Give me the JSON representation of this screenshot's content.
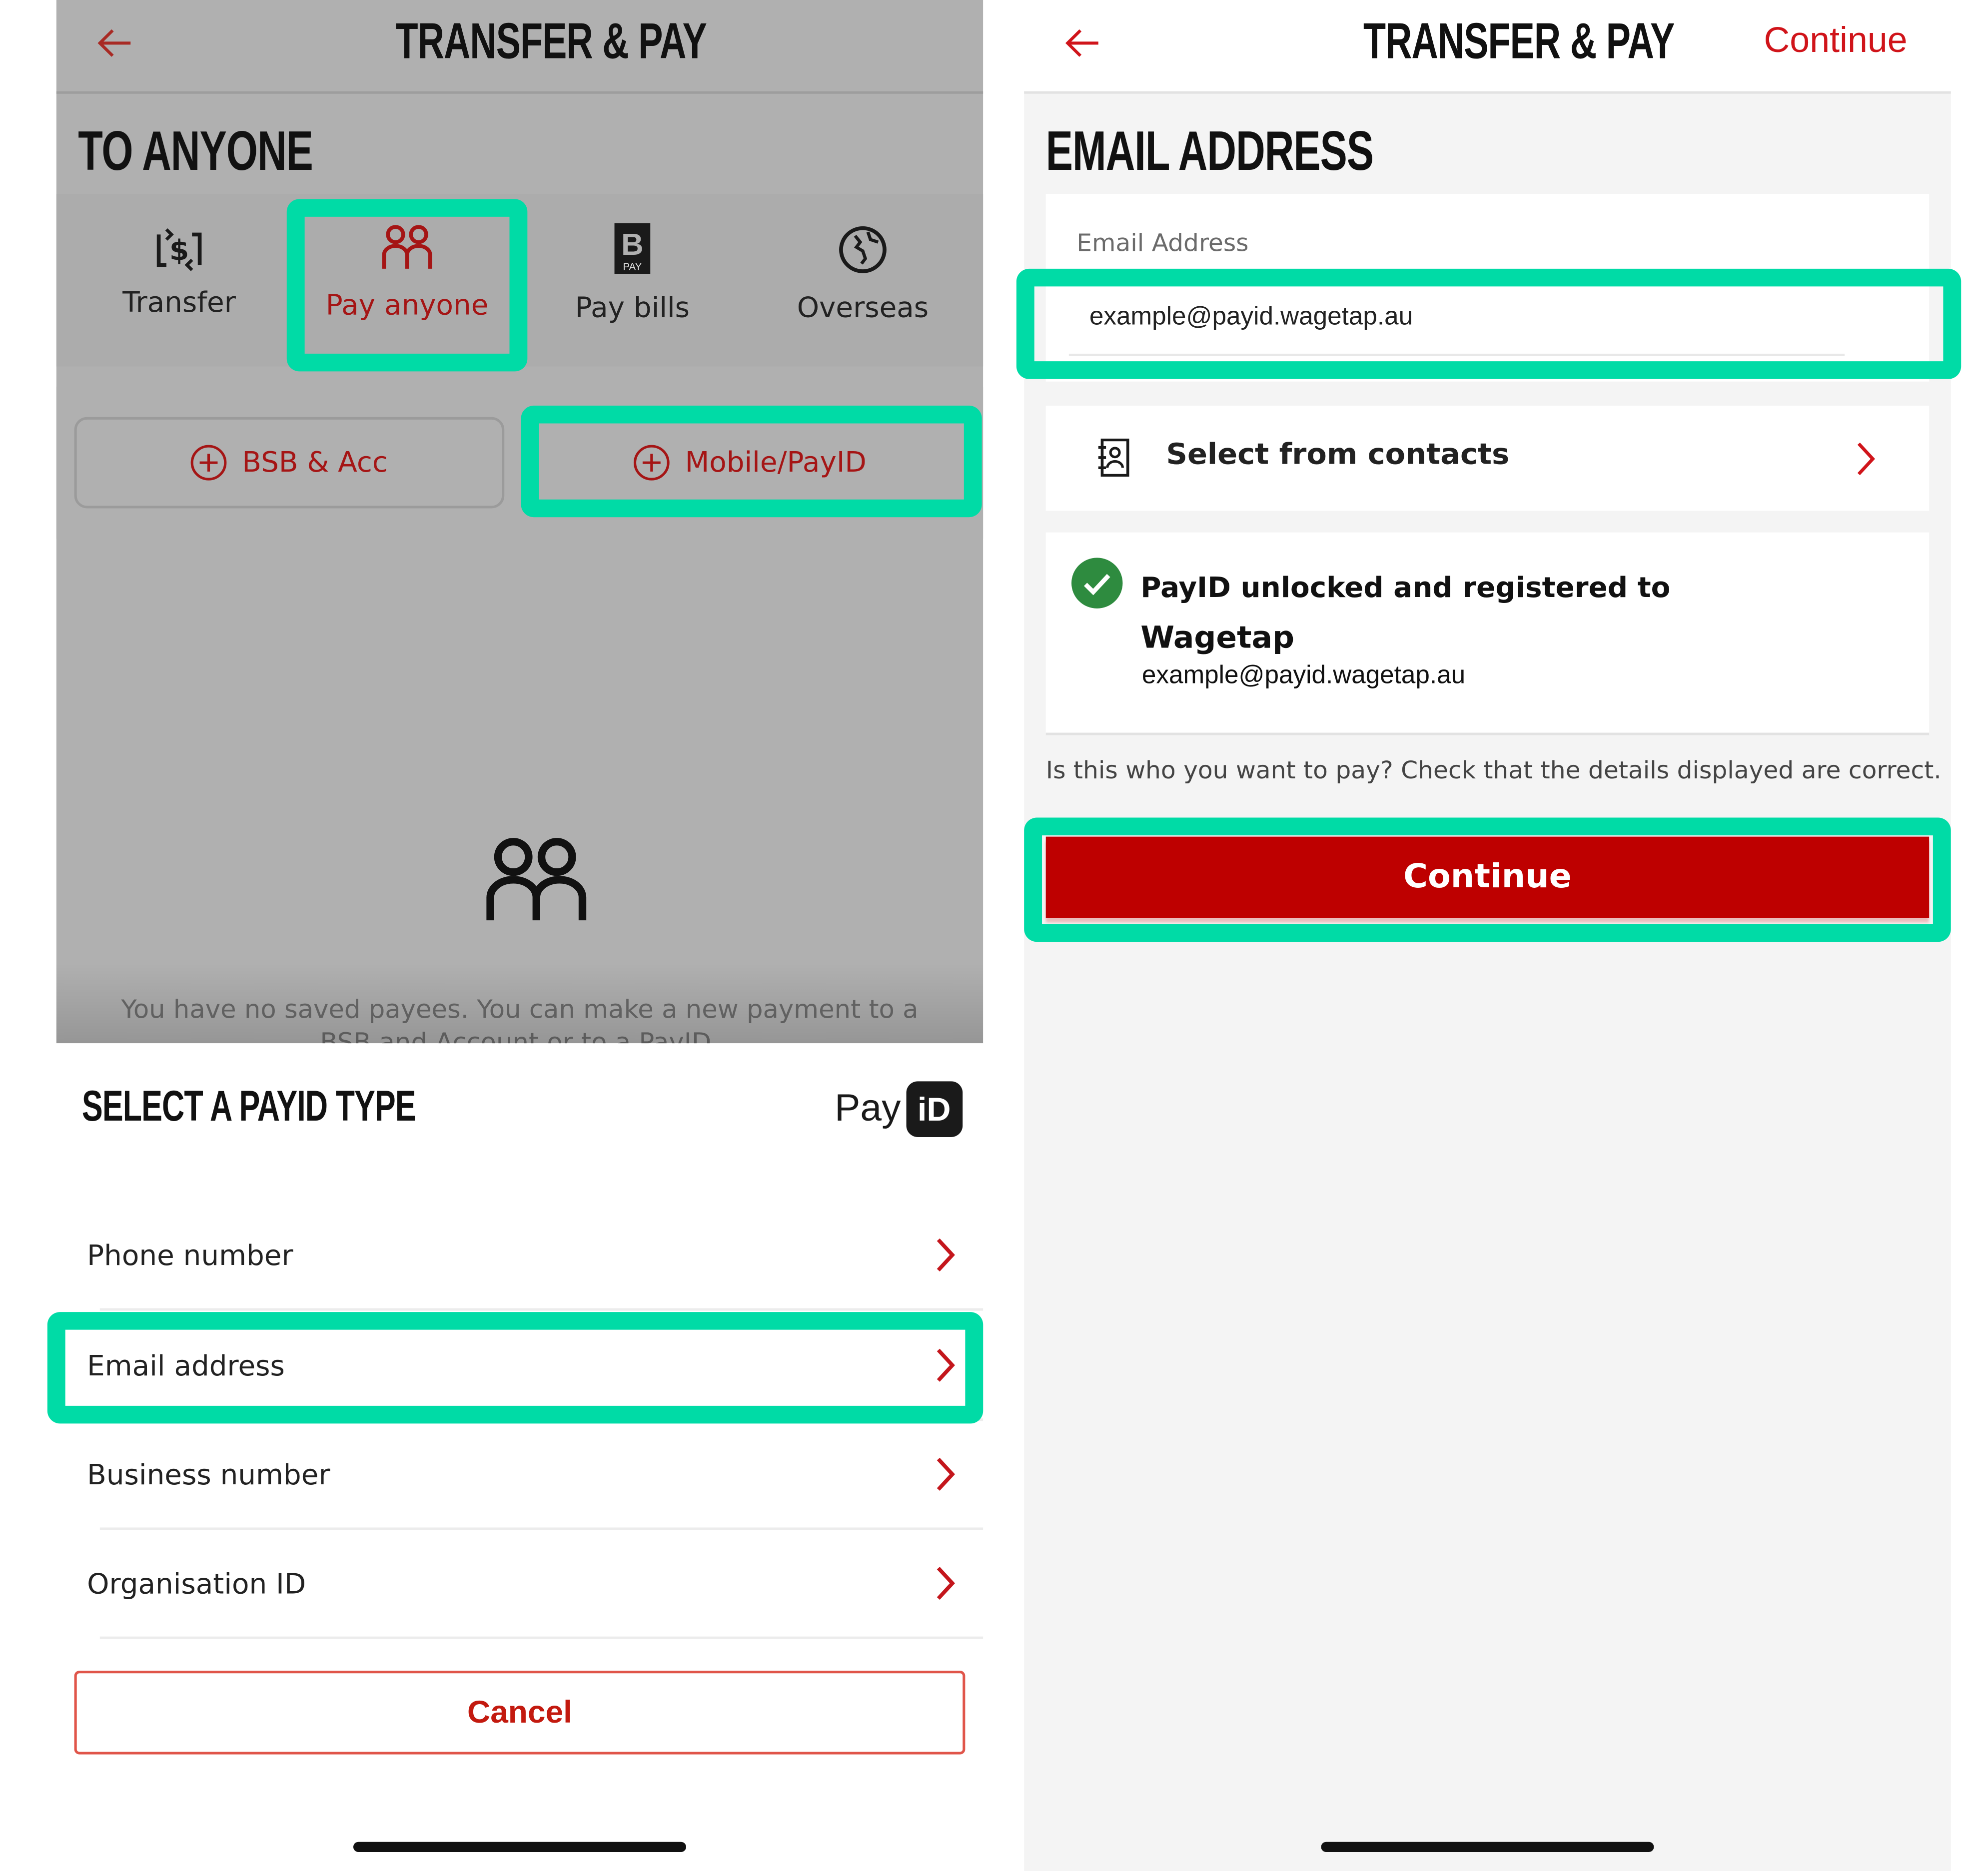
{
  "left_screen": {
    "header": {
      "title": "TRANSFER & PAY",
      "back_icon": "arrow-left-icon"
    },
    "section_title": "TO ANYONE",
    "tabs": [
      {
        "label": "Transfer",
        "icon": "transfer-dollar-icon",
        "active": false
      },
      {
        "label": "Pay anyone",
        "icon": "people-icon",
        "active": true
      },
      {
        "label": "Pay bills",
        "icon": "bpay-icon",
        "active": false
      },
      {
        "label": "Overseas",
        "icon": "globe-icon",
        "active": false
      }
    ],
    "new_payee_buttons": [
      {
        "label": "BSB & Acc",
        "icon": "plus-circle-icon"
      },
      {
        "label": "Mobile/PayID",
        "icon": "plus-circle-icon"
      }
    ],
    "empty_state": {
      "icon": "people-icon",
      "text": "You have no saved payees. You can make a new payment to a BSB and Account or to a PayID."
    },
    "sheet": {
      "title": "SELECT A PAYID TYPE",
      "logo_text": "Pay",
      "logo_badge": "iD",
      "options": [
        {
          "label": "Phone number"
        },
        {
          "label": "Email address"
        },
        {
          "label": "Business number"
        },
        {
          "label": "Organisation ID"
        }
      ],
      "cancel_label": "Cancel"
    }
  },
  "right_screen": {
    "header": {
      "title": "TRANSFER & PAY",
      "action_label": "Continue",
      "back_icon": "arrow-left-icon"
    },
    "section_title": "EMAIL ADDRESS",
    "email_field": {
      "label": "Email Address",
      "value": "example@payid.wagetap.au"
    },
    "contacts": {
      "label": "Select from contacts",
      "icon": "contacts-book-icon"
    },
    "registration": {
      "title": "PayID unlocked and registered to",
      "name": "Wagetap",
      "email": "example@payid.wagetap.au",
      "status_icon": "check-circle-icon"
    },
    "hint": "Is this who you want to pay? Check that the details displayed are correct.",
    "continue_label": "Continue"
  },
  "colors": {
    "brand_red": "#be0000",
    "highlight": "#00dba6",
    "success": "#2e8b3f"
  }
}
